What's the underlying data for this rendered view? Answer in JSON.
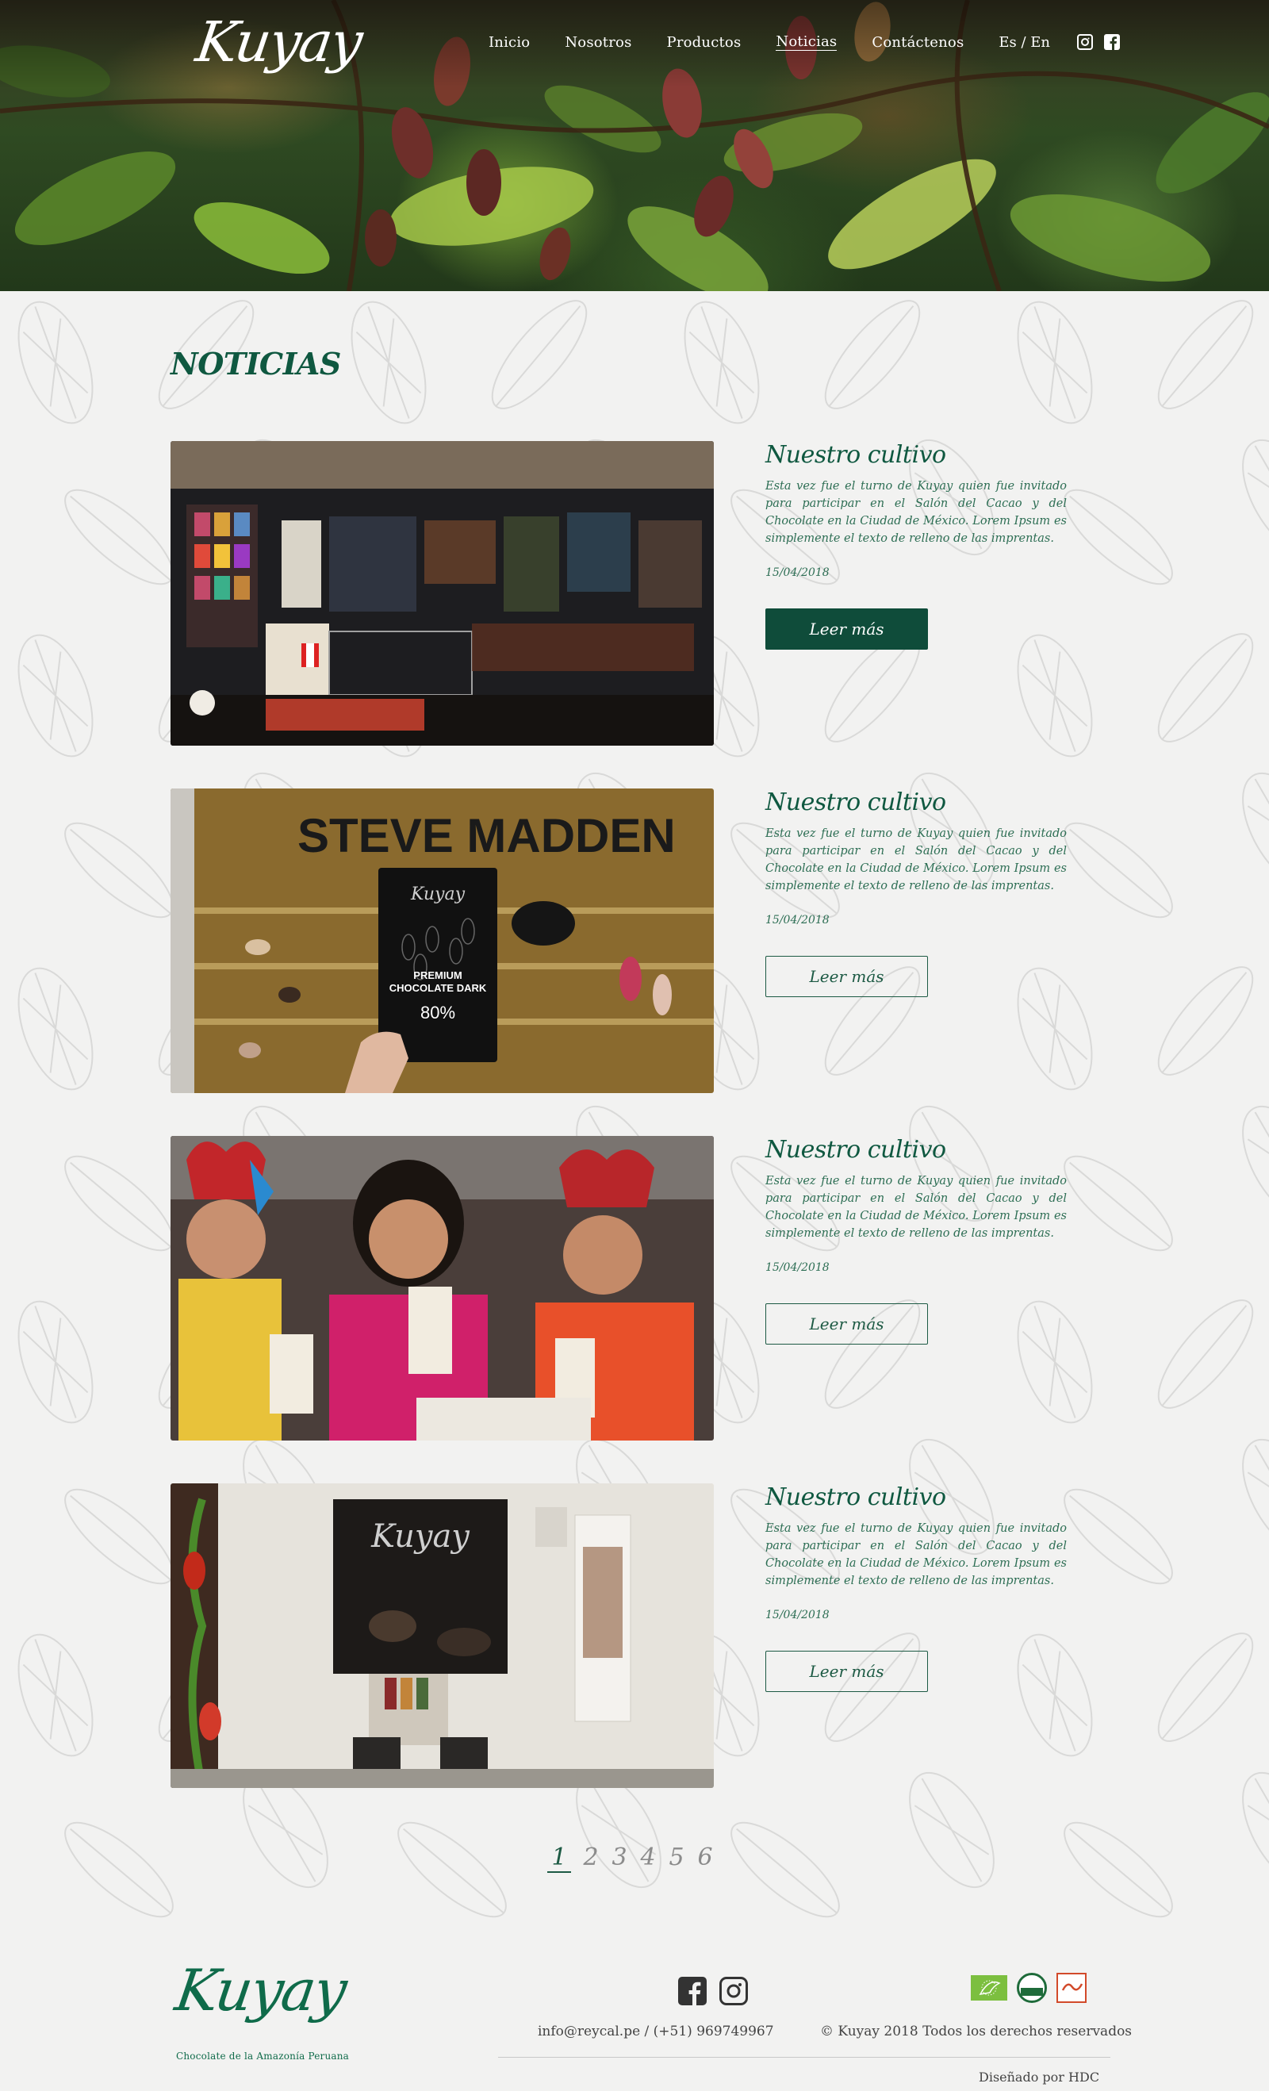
{
  "nav": {
    "logo_text": "Kuyay",
    "items": [
      {
        "label": "Inicio"
      },
      {
        "label": "Nosotros"
      },
      {
        "label": "Productos"
      },
      {
        "label": "Noticias"
      },
      {
        "label": "Contáctenos"
      }
    ],
    "language": "Es / En"
  },
  "page_title": "NOTICIAS",
  "articles": [
    {
      "title": "Nuestro cultivo",
      "body": "Esta vez fue el turno de Kuyay quien fue invitado para participar en el Salón del Cacao y del Chocolate en la Ciudad de México. Lorem Ipsum es simplemente el texto de relleno de las imprentas.",
      "date": "15/04/2018",
      "button": "Leer más"
    },
    {
      "title": "Nuestro cultivo",
      "body": "Esta vez fue el turno de Kuyay quien fue invitado para participar en el Salón del Cacao y del Chocolate en la Ciudad de México. Lorem Ipsum es simplemente el texto de relleno de las imprentas.",
      "date": "15/04/2018",
      "button": "Leer más",
      "photo_text": {
        "sign": "STEVE MADDEN",
        "brand": "Kuyay",
        "line1": "PREMIUM",
        "line2": "CHOCOLATE DARK",
        "pct": "80%"
      }
    },
    {
      "title": "Nuestro cultivo",
      "body": "Esta vez fue el turno de Kuyay quien fue invitado para participar en el Salón del Cacao y del Chocolate en la Ciudad de México. Lorem Ipsum es simplemente el texto de relleno de las imprentas.",
      "date": "15/04/2018",
      "button": "Leer más"
    },
    {
      "title": "Nuestro cultivo",
      "body": "Esta vez fue el turno de Kuyay quien fue invitado para participar en el Salón del Cacao y del Chocolate en la Ciudad de México. Lorem Ipsum es simplemente el texto de relleno de las imprentas.",
      "date": "15/04/2018",
      "button": "Leer más",
      "photo_text": {
        "brand": "Kuyay"
      }
    }
  ],
  "pagination": [
    "1",
    "2",
    "3",
    "4",
    "5",
    "6"
  ],
  "footer": {
    "logo_text": "Kuyay",
    "tagline": "Chocolate de la Amazonía Peruana",
    "contact": "info@reycal.pe / (+51) 969749967",
    "copyright": "© Kuyay 2018 Todos los derechos reservados",
    "designed_by": "Diseñado por HDC"
  },
  "colors": {
    "brand_green": "#0f4c3a",
    "text_green": "#1d5a44",
    "background": "#f2f2f1"
  },
  "icons": [
    "instagram-icon",
    "facebook-icon"
  ]
}
